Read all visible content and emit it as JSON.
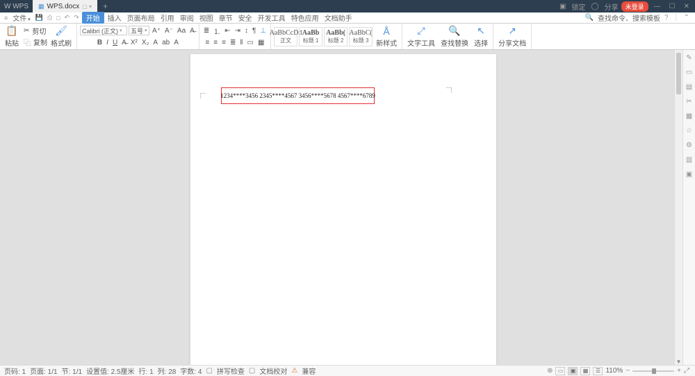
{
  "titlebar": {
    "brand": "W WPS",
    "doc_name": "WPS.docx",
    "add_tab": "+",
    "lock_label": "锁定",
    "user_label": "分享",
    "login": "未登录"
  },
  "menu": {
    "file": "文件",
    "tabs": [
      "开始",
      "插入",
      "页面布局",
      "引用",
      "审阅",
      "视图",
      "章节",
      "安全",
      "开发工具",
      "特色应用",
      "文档助手"
    ],
    "search_ph": "查找命令、搜索模板"
  },
  "ribbon": {
    "paste_label": "粘贴",
    "cut": "剪切",
    "copy": "复制",
    "fmtpaint": "格式刷",
    "font_name": "Calibri (正文)",
    "font_size": "五号",
    "styles": [
      {
        "preview": "AaBbCcDd",
        "label": "正文"
      },
      {
        "preview": "AaBb",
        "label": "标题 1"
      },
      {
        "preview": "AaBb(",
        "label": "标题 2"
      },
      {
        "preview": "AaBbC(",
        "label": "标题 3"
      }
    ],
    "newstyle": "新样式",
    "texttool": "文字工具",
    "findreplace": "查找替换",
    "select": "选择",
    "share": "分享文档"
  },
  "document": {
    "content": "1234****3456 2345****4567 3456****5678 4567****6789"
  },
  "status": {
    "page_label": "页码: 1",
    "page_range": "页面: 1/1",
    "section": "节: 1/1",
    "position": "设置值: 2.5厘米",
    "line": "行: 1",
    "col": "列: 28",
    "chars": "字数: 4",
    "spellcheck": "拼写检查",
    "docproof": "文档校对",
    "compat": "兼容",
    "zoom": "110%"
  }
}
